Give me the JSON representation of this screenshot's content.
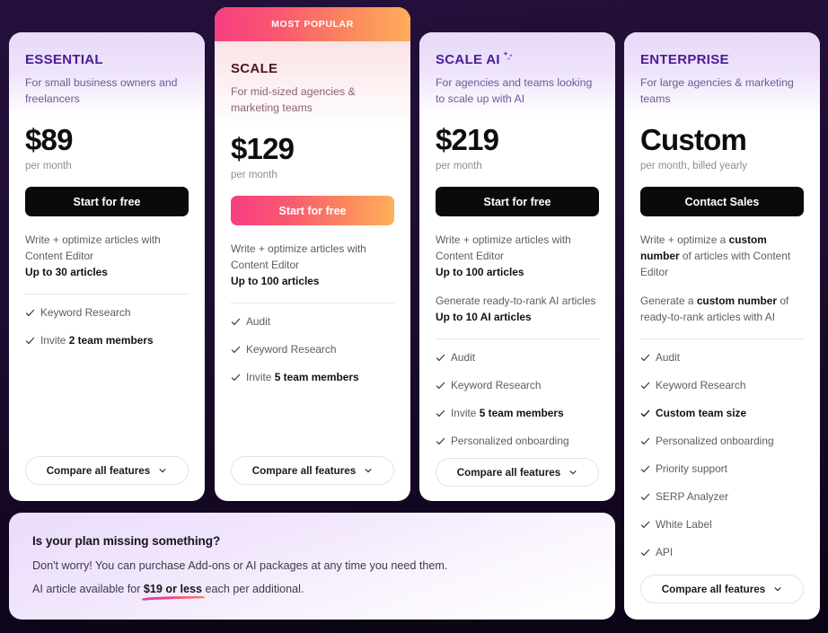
{
  "background": {
    "color_top": "#23103b",
    "color_bottom": "#0b0414"
  },
  "accents": {
    "gradient_pink": "#f73e83",
    "gradient_orange": "#ffad5c",
    "purple_heading": "#4a1d96",
    "dark_button": "#0a0a0a"
  },
  "plans": [
    {
      "id": "essential",
      "name": "ESSENTIAL",
      "description": "For small business owners and freelancers",
      "price": "$89",
      "price_note": "per month",
      "cta_label": "Start for free",
      "cta_style": "dark",
      "badge": null,
      "blurbs": [
        {
          "text": "Write + optimize articles with Content Editor",
          "bold_suffix": "Up to 30 articles"
        }
      ],
      "features": [
        {
          "label": "Keyword Research",
          "bold": false
        },
        {
          "label": "Invite 2 team members",
          "bold_part": "2 team members",
          "plain_part": "Invite "
        }
      ],
      "compare_label": "Compare all features"
    },
    {
      "id": "scale",
      "name": "SCALE",
      "description": "For mid-sized agencies & marketing teams",
      "price": "$129",
      "price_note": "per month",
      "cta_label": "Start for free",
      "cta_style": "gradient",
      "badge": "MOST POPULAR",
      "blurbs": [
        {
          "text": "Write + optimize articles with Content Editor",
          "bold_suffix": "Up to 100 articles"
        }
      ],
      "features": [
        {
          "label": "Audit",
          "bold": false
        },
        {
          "label": "Keyword Research",
          "bold": false
        },
        {
          "label": "Invite 5 team members",
          "bold_part": "5 team members",
          "plain_part": "Invite "
        }
      ],
      "compare_label": "Compare all features"
    },
    {
      "id": "scale-ai",
      "name": "SCALE AI",
      "name_icon": "sparkle-icon",
      "description": "For agencies and teams looking to scale up with AI",
      "price": "$219",
      "price_note": "per month",
      "cta_label": "Start for free",
      "cta_style": "dark",
      "badge": null,
      "blurbs": [
        {
          "text": "Write + optimize articles with Content Editor",
          "bold_suffix": "Up to 100 articles"
        },
        {
          "text": "Generate ready-to-rank AI articles",
          "bold_suffix": "Up to 10 AI articles"
        }
      ],
      "features": [
        {
          "label": "Audit",
          "bold": false
        },
        {
          "label": "Keyword Research",
          "bold": false
        },
        {
          "label": "Invite 5 team members",
          "bold_part": "5 team members",
          "plain_part": "Invite "
        },
        {
          "label": "Personalized onboarding",
          "bold": false
        }
      ],
      "compare_label": "Compare all features"
    },
    {
      "id": "enterprise",
      "name": "ENTERPRISE",
      "description": "For large agencies & marketing teams",
      "price": "Custom",
      "price_note": "per month, billed yearly",
      "cta_label": "Contact Sales",
      "cta_style": "dark",
      "badge": null,
      "blurbs": [
        {
          "prefix": "Write + optimize a ",
          "bold": "custom number",
          "suffix": " of articles with Content Editor"
        },
        {
          "prefix": "Generate a ",
          "bold": "custom number",
          "suffix": " of ready-to-rank articles with AI"
        }
      ],
      "features": [
        {
          "label": "Audit",
          "bold": false
        },
        {
          "label": "Keyword Research",
          "bold": false
        },
        {
          "label": "Custom team size",
          "bold": true
        },
        {
          "label": "Personalized onboarding",
          "bold": false
        },
        {
          "label": "Priority support",
          "bold": false
        },
        {
          "label": "SERP Analyzer",
          "bold": false
        },
        {
          "label": "White Label",
          "bold": false
        },
        {
          "label": "API",
          "bold": false
        }
      ],
      "compare_label": "Compare all features"
    }
  ],
  "promo": {
    "title": "Is your plan missing something?",
    "line1": "Don't worry! You can purchase Add-ons or AI packages at any time you need them.",
    "line2_prefix": "AI article available for ",
    "line2_highlight": "$19 or less",
    "line2_suffix": " each per additional."
  }
}
